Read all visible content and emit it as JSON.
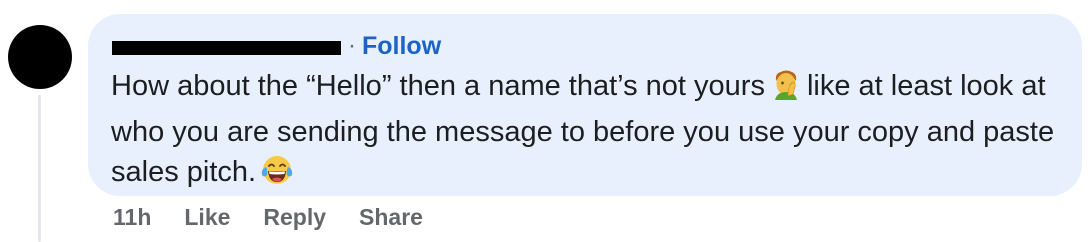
{
  "comment": {
    "separator": "·",
    "follow_label": "Follow",
    "text_part1": "How about the “Hello” then a name that’s not yours",
    "emoji1": "man-facepalming-emoji",
    "text_part2": "like at least look at who you are sending the message to before you use your copy and paste sales pitch.",
    "emoji2": "face-with-tears-of-joy-emoji"
  },
  "actions": {
    "timestamp": "11h",
    "like_label": "Like",
    "reply_label": "Reply",
    "share_label": "Share"
  },
  "colors": {
    "bubble_bg": "#e7f0fc",
    "follow": "#1b63c7",
    "text": "#1c1e21",
    "muted": "#65676b"
  }
}
